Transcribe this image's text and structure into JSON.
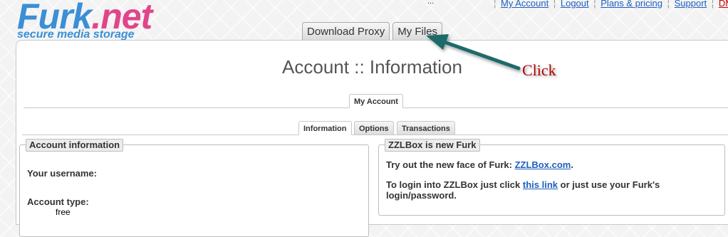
{
  "logo": {
    "name_part1": "Furk",
    "name_part2": ".net",
    "tagline": "secure media storage"
  },
  "header_ellipsis": "...",
  "topnav": {
    "items": [
      "My Account",
      "Logout",
      "Plans & pricing",
      "Support",
      "DMCA"
    ],
    "separator": "¦",
    "colors": {
      "link": "#1f5fbf",
      "dmca": "#cc0000"
    }
  },
  "main_tabs": [
    "Download Proxy",
    "My Files"
  ],
  "page_title": "Account :: Information",
  "account_tab": "My Account",
  "sub_tabs": [
    "Information",
    "Options",
    "Transactions"
  ],
  "account_info": {
    "legend": "Account information",
    "username_label": "Your username:",
    "type_label": "Account type:",
    "type_value": "free"
  },
  "zzlbox": {
    "legend": "ZZLBox is new Furk",
    "line1_prefix": "Try out the new face of Furk:",
    "line1_link": "ZZLBox.com",
    "line1_suffix": ".",
    "line2_prefix": "To login into ZZLBox just click",
    "line2_link": "this link",
    "line2_suffix": "or just use your Furk's login/password."
  },
  "annotation": {
    "text": "Click",
    "arrow_color": "#1e6b6b",
    "text_color": "#b30000"
  }
}
